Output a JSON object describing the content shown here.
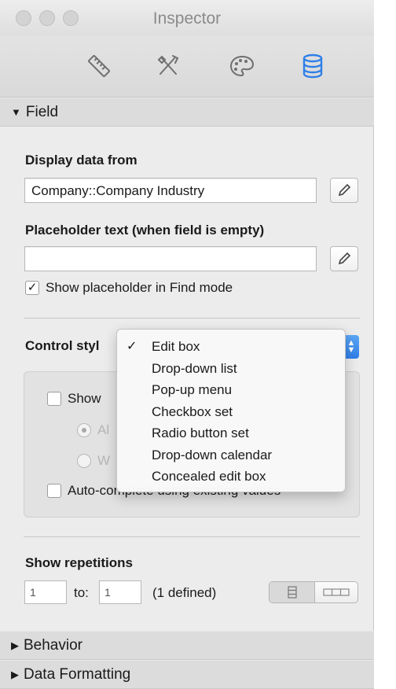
{
  "window": {
    "title": "Inspector"
  },
  "toolbar": {
    "tools": [
      {
        "icon": "ruler-icon"
      },
      {
        "icon": "tools-icon"
      },
      {
        "icon": "palette-icon"
      },
      {
        "icon": "database-icon",
        "active": true
      }
    ],
    "active_color": "#2f7fe8"
  },
  "field_section": {
    "header": "Field",
    "display_data_label": "Display data from",
    "display_data_value": "Company::Company Industry",
    "placeholder_label": "Placeholder text (when field is empty)",
    "placeholder_value": "",
    "show_placeholder_label": "Show placeholder in Find mode",
    "show_placeholder_checked": true,
    "control_style_label": "Control styl",
    "show_label": "Show",
    "radio_1_label": "Al",
    "radio_2_label": "W",
    "auto_complete_label": "Auto-complete using existing values",
    "repetitions_label": "Show repetitions",
    "rep_from": "1",
    "rep_to_label": "to:",
    "rep_to": "1",
    "rep_defined": "(1 defined)"
  },
  "control_style_menu": {
    "items": [
      {
        "label": "Edit box",
        "checked": true
      },
      {
        "label": "Drop-down list",
        "checked": false
      },
      {
        "label": "Pop-up menu",
        "checked": false
      },
      {
        "label": "Checkbox set",
        "checked": false
      },
      {
        "label": "Radio button set",
        "checked": false
      },
      {
        "label": "Drop-down calendar",
        "checked": false
      },
      {
        "label": "Concealed edit box",
        "checked": false
      }
    ]
  },
  "collapsed_sections": [
    "Behavior",
    "Data Formatting"
  ]
}
